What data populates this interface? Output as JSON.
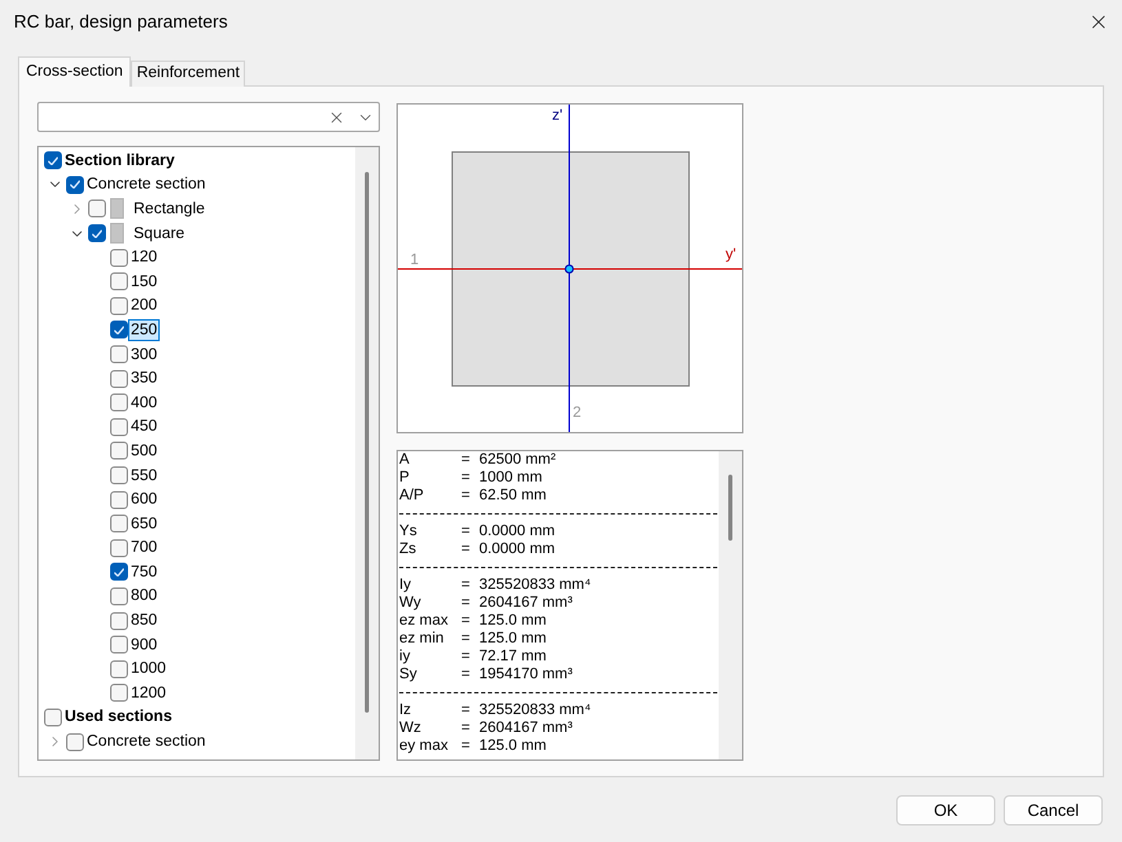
{
  "window": {
    "title": "RC bar, design parameters"
  },
  "tabs": [
    {
      "label": "Cross-section",
      "selected": true
    },
    {
      "label": "Reinforcement",
      "selected": false
    }
  ],
  "tree": [
    {
      "kind": "library",
      "label": "Section library",
      "checked": true,
      "selected": false,
      "children": [
        {
          "kind": "group",
          "label": "Concrete section",
          "checked": true,
          "expanded": true,
          "selected": false,
          "children": [
            {
              "kind": "shape",
              "label": "Rectangle",
              "checked": false,
              "expanded": false,
              "selected": false
            },
            {
              "kind": "shape",
              "label": "Square",
              "checked": true,
              "expanded": true,
              "selected": false,
              "children": [
                {
                  "kind": "size",
                  "label": "120",
                  "checked": false,
                  "selected": false
                },
                {
                  "kind": "size",
                  "label": "150",
                  "checked": false,
                  "selected": false
                },
                {
                  "kind": "size",
                  "label": "200",
                  "checked": false,
                  "selected": false
                },
                {
                  "kind": "size",
                  "label": "250",
                  "checked": true,
                  "selected": true
                },
                {
                  "kind": "size",
                  "label": "300",
                  "checked": false,
                  "selected": false
                },
                {
                  "kind": "size",
                  "label": "350",
                  "checked": false,
                  "selected": false
                },
                {
                  "kind": "size",
                  "label": "400",
                  "checked": false,
                  "selected": false
                },
                {
                  "kind": "size",
                  "label": "450",
                  "checked": false,
                  "selected": false
                },
                {
                  "kind": "size",
                  "label": "500",
                  "checked": false,
                  "selected": false
                },
                {
                  "kind": "size",
                  "label": "550",
                  "checked": false,
                  "selected": false
                },
                {
                  "kind": "size",
                  "label": "600",
                  "checked": false,
                  "selected": false
                },
                {
                  "kind": "size",
                  "label": "650",
                  "checked": false,
                  "selected": false
                },
                {
                  "kind": "size",
                  "label": "700",
                  "checked": false,
                  "selected": false
                },
                {
                  "kind": "size",
                  "label": "750",
                  "checked": true,
                  "selected": false
                },
                {
                  "kind": "size",
                  "label": "800",
                  "checked": false,
                  "selected": false
                },
                {
                  "kind": "size",
                  "label": "850",
                  "checked": false,
                  "selected": false
                },
                {
                  "kind": "size",
                  "label": "900",
                  "checked": false,
                  "selected": false
                },
                {
                  "kind": "size",
                  "label": "1000",
                  "checked": false,
                  "selected": false
                },
                {
                  "kind": "size",
                  "label": "1200",
                  "checked": false,
                  "selected": false
                }
              ]
            }
          ]
        }
      ]
    },
    {
      "kind": "library",
      "label": "Used sections",
      "checked": false,
      "selected": false,
      "children": [
        {
          "kind": "group",
          "label": "Concrete section",
          "checked": false,
          "expanded": false,
          "selected": false
        }
      ]
    }
  ],
  "section_view": {
    "z_label": "z'",
    "y_label": "y'",
    "start_label": "1",
    "end_label": "2"
  },
  "properties": [
    {
      "rows": [
        {
          "name": "A",
          "sign": "=",
          "value": "62500 mm²"
        },
        {
          "name": "P",
          "sign": "=",
          "value": "1000 mm"
        },
        {
          "name": "A/P",
          "sign": "=",
          "value": "62.50 mm"
        }
      ]
    },
    {
      "rows": [
        {
          "name": "Ys",
          "sign": "=",
          "value": "0.0000 mm"
        },
        {
          "name": "Zs",
          "sign": "=",
          "value": "0.0000 mm"
        }
      ]
    },
    {
      "rows": [
        {
          "name": "Iy",
          "sign": "=",
          "value": "325520833 mm⁴"
        },
        {
          "name": "Wy",
          "sign": "=",
          "value": "2604167 mm³"
        },
        {
          "name": "ez max",
          "sign": "=",
          "value": "125.0 mm"
        },
        {
          "name": "ez min",
          "sign": "=",
          "value": "125.0 mm"
        },
        {
          "name": "iy",
          "sign": "=",
          "value": "72.17 mm"
        },
        {
          "name": "Sy",
          "sign": "=",
          "value": "1954170 mm³"
        }
      ]
    },
    {
      "rows": [
        {
          "name": "Iz",
          "sign": "=",
          "value": "325520833 mm⁴"
        },
        {
          "name": "Wz",
          "sign": "=",
          "value": "2604167 mm³"
        },
        {
          "name": "ey max",
          "sign": "=",
          "value": "125.0 mm"
        }
      ]
    }
  ],
  "buttons": [
    {
      "label": "OK"
    },
    {
      "label": "Cancel"
    }
  ]
}
